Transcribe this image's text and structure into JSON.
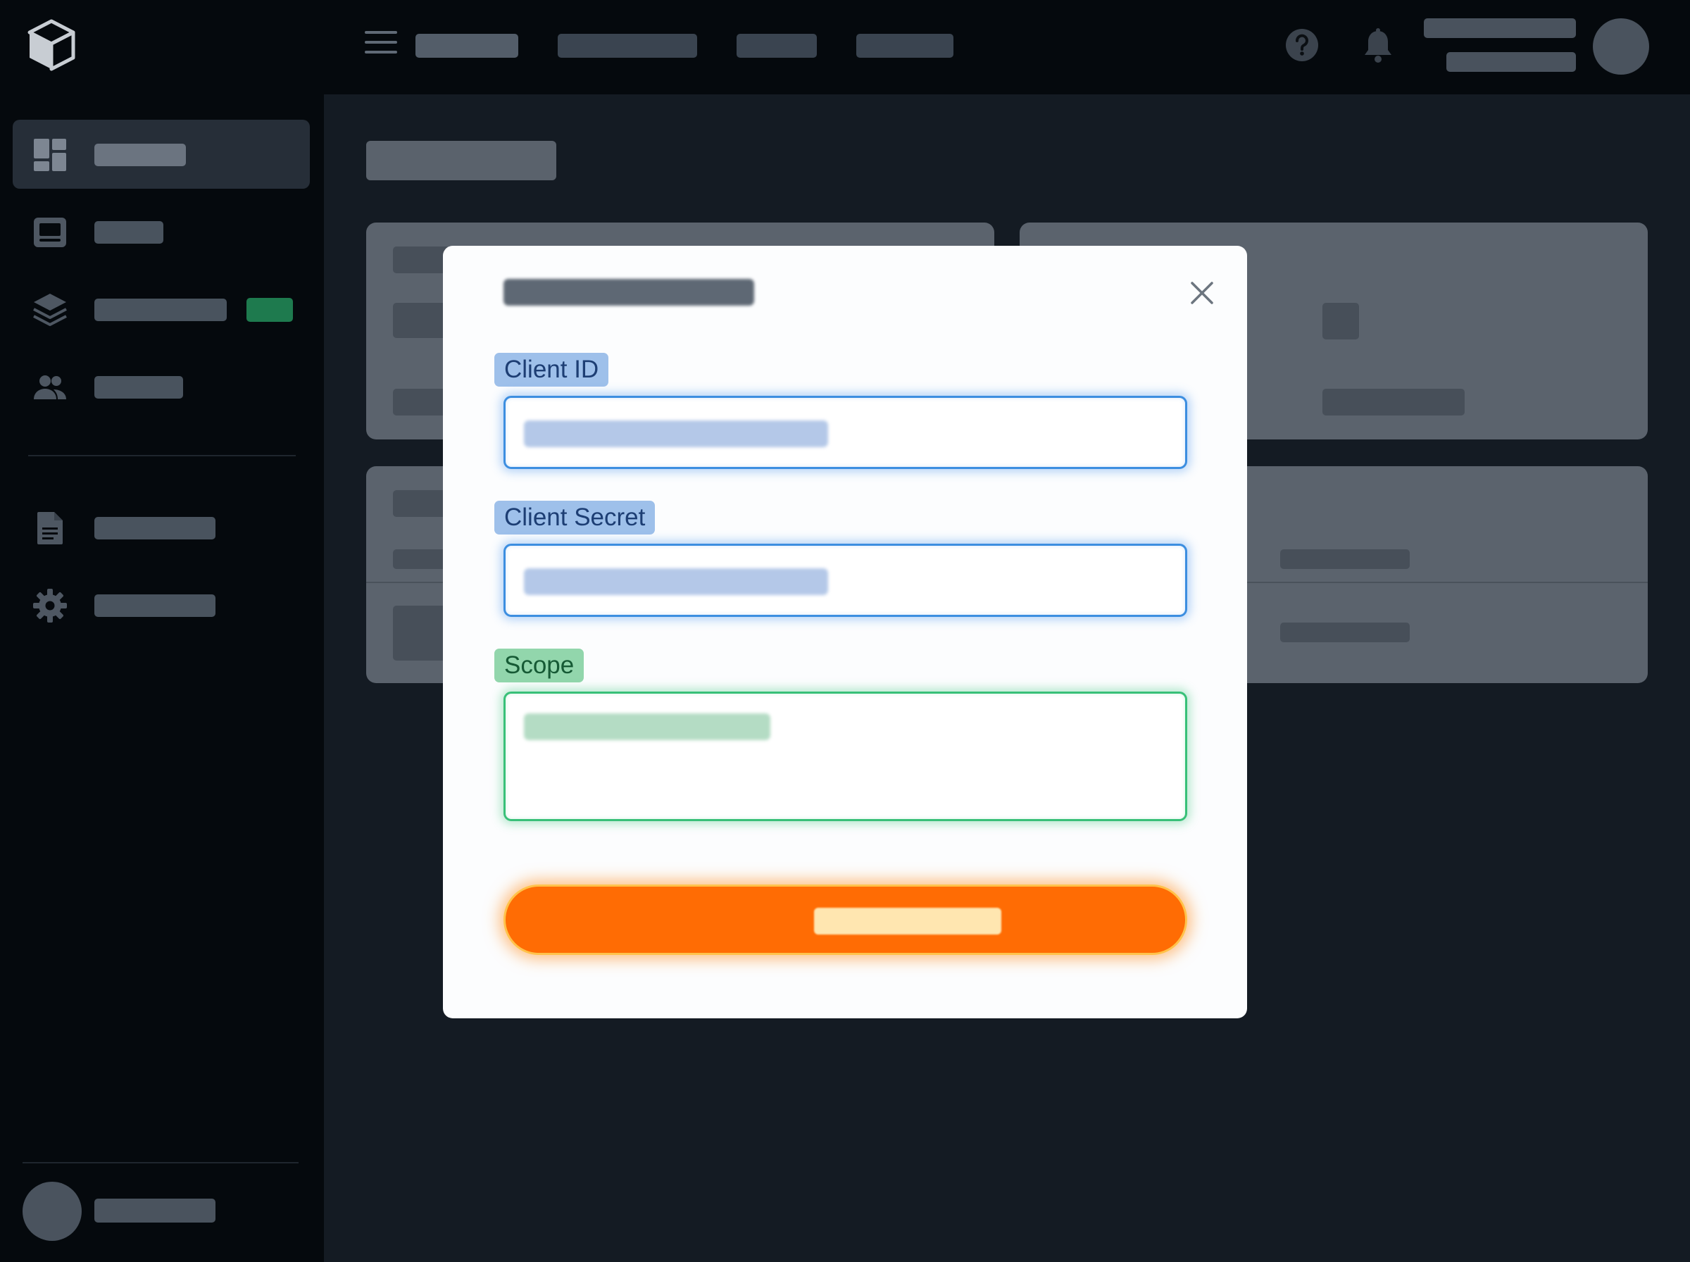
{
  "form": {
    "client_id": {
      "label": "Client ID",
      "value": ""
    },
    "client_secret": {
      "label": "Client Secret",
      "value": ""
    },
    "scope": {
      "label": "Scope",
      "value": ""
    }
  },
  "colors": {
    "top_bar": "#05090d",
    "sidebar": "#05090d",
    "main_background": "#141b23",
    "modal_background": "#fcfdfe",
    "input_blue": "#3c8ee0",
    "input_green": "#38c078",
    "submit_button": "#ff6c04",
    "sidebar_badge": "#1e7a4e"
  },
  "icons": {
    "app_logo": "cube-icon",
    "menu": "hamburger-menu-icon",
    "help": "help-circle-icon",
    "notifications": "bell-icon",
    "sidebar": [
      "dashboard-icon",
      "monitor-icon",
      "layers-icon",
      "users-icon",
      "document-icon",
      "gear-icon"
    ],
    "close": "close-icon"
  }
}
